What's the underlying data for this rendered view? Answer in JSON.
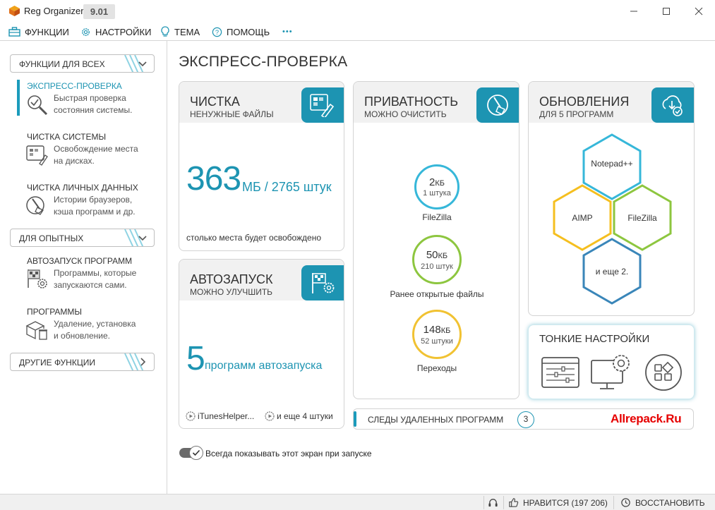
{
  "app": {
    "title": "Reg Organizer",
    "version": "9.01",
    "window_controls": [
      "minimize-icon",
      "maximize-icon",
      "close-icon"
    ]
  },
  "menu": {
    "items": [
      {
        "label": "ФУНКЦИИ",
        "icon": "toolbox-icon"
      },
      {
        "label": "НАСТРОЙКИ",
        "icon": "gear-icon"
      },
      {
        "label": "ТЕМА",
        "icon": "lightbulb-icon"
      },
      {
        "label": "ПОМОЩЬ",
        "icon": "help-icon"
      }
    ],
    "more_label": "•••"
  },
  "sidebar": {
    "groups": [
      {
        "label": "ФУНКЦИИ ДЛЯ ВСЕХ",
        "chevron": "chevron-down-icon"
      },
      {
        "label": "ДЛЯ ОПЫТНЫХ",
        "chevron": "chevron-down-icon"
      },
      {
        "label": "ДРУГИЕ ФУНКЦИИ",
        "chevron": "chevron-right-icon"
      }
    ],
    "items": [
      {
        "title": "ЭКСПРЕСС-ПРОВЕРКА",
        "desc1": "Быстрая проверка",
        "desc2": "состояния системы.",
        "icon": "magnifier-icon",
        "active": true
      },
      {
        "title": "ЧИСТКА СИСТЕМЫ",
        "desc1": "Освобождение места",
        "desc2": "на дисках.",
        "icon": "disk-clean-icon"
      },
      {
        "title": "ЧИСТКА ЛИЧНЫХ ДАННЫХ",
        "desc1": "Истории браузеров,",
        "desc2": "кэша программ и др.",
        "icon": "broom-icon"
      },
      {
        "title": "АВТОЗАПУСК ПРОГРАММ",
        "desc1": "Программы, которые",
        "desc2": "запускаются сами.",
        "icon": "flag-gear-icon"
      },
      {
        "title": "ПРОГРАММЫ",
        "desc1": "Удаление, установка",
        "desc2": "и обновление.",
        "icon": "box-trash-icon"
      }
    ]
  },
  "main": {
    "title": "ЭКСПРЕСС-ПРОВЕРКА",
    "cleanup": {
      "title": "ЧИСТКА",
      "subtitle": "НЕНУЖНЫЕ ФАЙЛЫ",
      "value": "363",
      "unit": "МБ / 2765 штук",
      "note": "столько места будет освобождено"
    },
    "autorun": {
      "title": "АВТОЗАПУСК",
      "subtitle": "МОЖНО УЛУЧШИТЬ",
      "value": "5",
      "unit": "программ автозапуска",
      "items": [
        "iTunesHelper...",
        "и еще 4 штуки"
      ]
    },
    "privacy": {
      "title": "ПРИВАТНОСТЬ",
      "subtitle": "МОЖНО ОЧИСТИТЬ",
      "rings": [
        {
          "value": "2",
          "unit": "КБ",
          "count": "1 штука",
          "label": "FileZilla",
          "color": "#36b7d9"
        },
        {
          "value": "50",
          "unit": "КБ",
          "count": "210 штук",
          "label": "Ранее открытые файлы",
          "color": "#8dc63f"
        },
        {
          "value": "148",
          "unit": "КБ",
          "count": "52 штуки",
          "label": "Переходы",
          "color": "#f1c232"
        }
      ]
    },
    "updates": {
      "title": "ОБНОВЛЕНИЯ",
      "subtitle": "ДЛЯ 5 ПРОГРАММ",
      "hexes": [
        {
          "label": "Notepad++",
          "color": "#36b7d9"
        },
        {
          "label": "AIMP",
          "color": "#f5bf1f"
        },
        {
          "label": "FileZilla",
          "color": "#8dc63f"
        },
        {
          "label": "и еще 2.",
          "color": "#3a86b9"
        }
      ]
    },
    "tweaks": {
      "title": "ТОНКИЕ НАСТРОЙКИ",
      "icons": [
        "settings-window-icon",
        "monitor-gear-icon",
        "apps-grid-icon"
      ]
    },
    "traces": {
      "label": "СЛЕДЫ УДАЛЕННЫХ ПРОГРАММ",
      "count": "3",
      "brand": "Allrepack.Ru"
    },
    "startup_toggle": {
      "label": "Всегда показывать этот экран при запуске",
      "checked": true
    }
  },
  "statusbar": {
    "like_label": "НРАВИТСЯ (197 206)",
    "restore_label": "ВОССТАНОВИТЬ"
  },
  "colors": {
    "accent": "#1d94b2",
    "brand_red": "#e60000"
  }
}
